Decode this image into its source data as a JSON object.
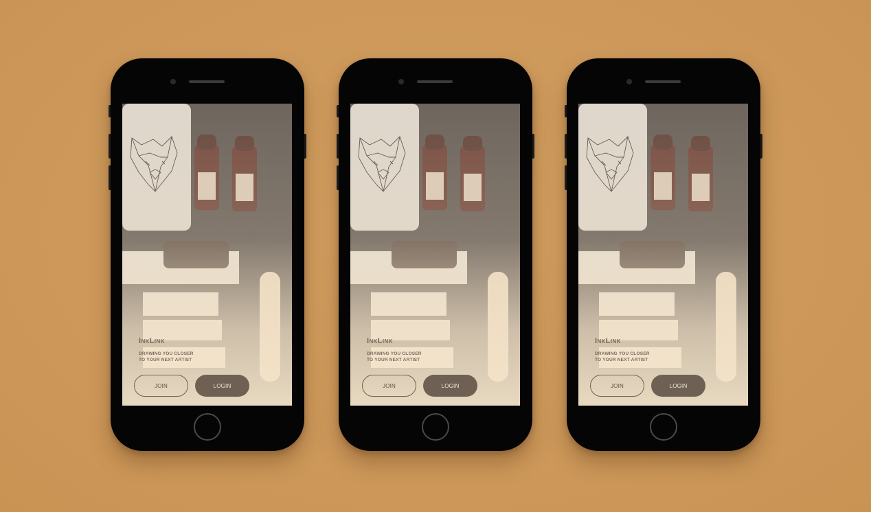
{
  "screens": [
    {
      "brand": "InkLink",
      "tagline_line1": "DRAWING YOU CLOSER",
      "tagline_line2": "TO YOUR NEXT ARTIST",
      "join_label": "JOIN",
      "login_label": "LOGIN"
    },
    {
      "brand": "InkLink",
      "tagline_line1": "DRAWING YOU CLOSER",
      "tagline_line2": "TO YOUR NEXT ARTIST",
      "join_label": "JOIN",
      "login_label": "LOGIN"
    },
    {
      "brand": "InkLink",
      "tagline_line1": "DRAWING YOU CLOSER",
      "tagline_line2": "TO YOUR NEXT ARTIST",
      "join_label": "JOIN",
      "login_label": "LOGIN"
    }
  ],
  "colors": {
    "background": "#cf9a5c",
    "phone_body": "#050505",
    "brand_text": "#7a6a5c",
    "login_button": "#6e6154",
    "login_text": "#f1e6d6"
  },
  "icons": {
    "photo": "tattoo-supplies-photo",
    "home_button": "home-button-icon"
  }
}
